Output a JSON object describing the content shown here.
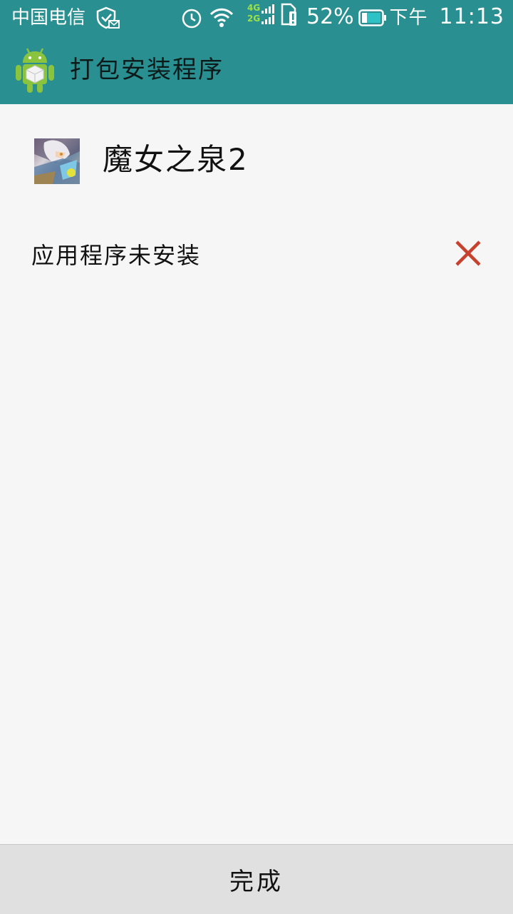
{
  "status_bar": {
    "carrier": "中国电信",
    "net_top": "4G",
    "net_bottom": "2G",
    "battery_percent": "52%",
    "ampm": "下午",
    "time": "11:13"
  },
  "action_bar": {
    "title": "打包安装程序",
    "icon": "android-package-icon"
  },
  "app": {
    "name": "魔女之泉2",
    "icon": "app-thumbnail"
  },
  "install_status": {
    "message": "应用程序未安装",
    "icon": "close-icon",
    "icon_color": "#c8402e"
  },
  "footer": {
    "done_label": "完成"
  },
  "colors": {
    "primary": "#298f91",
    "background": "#f6f6f6",
    "footer": "#e0e0e0"
  }
}
